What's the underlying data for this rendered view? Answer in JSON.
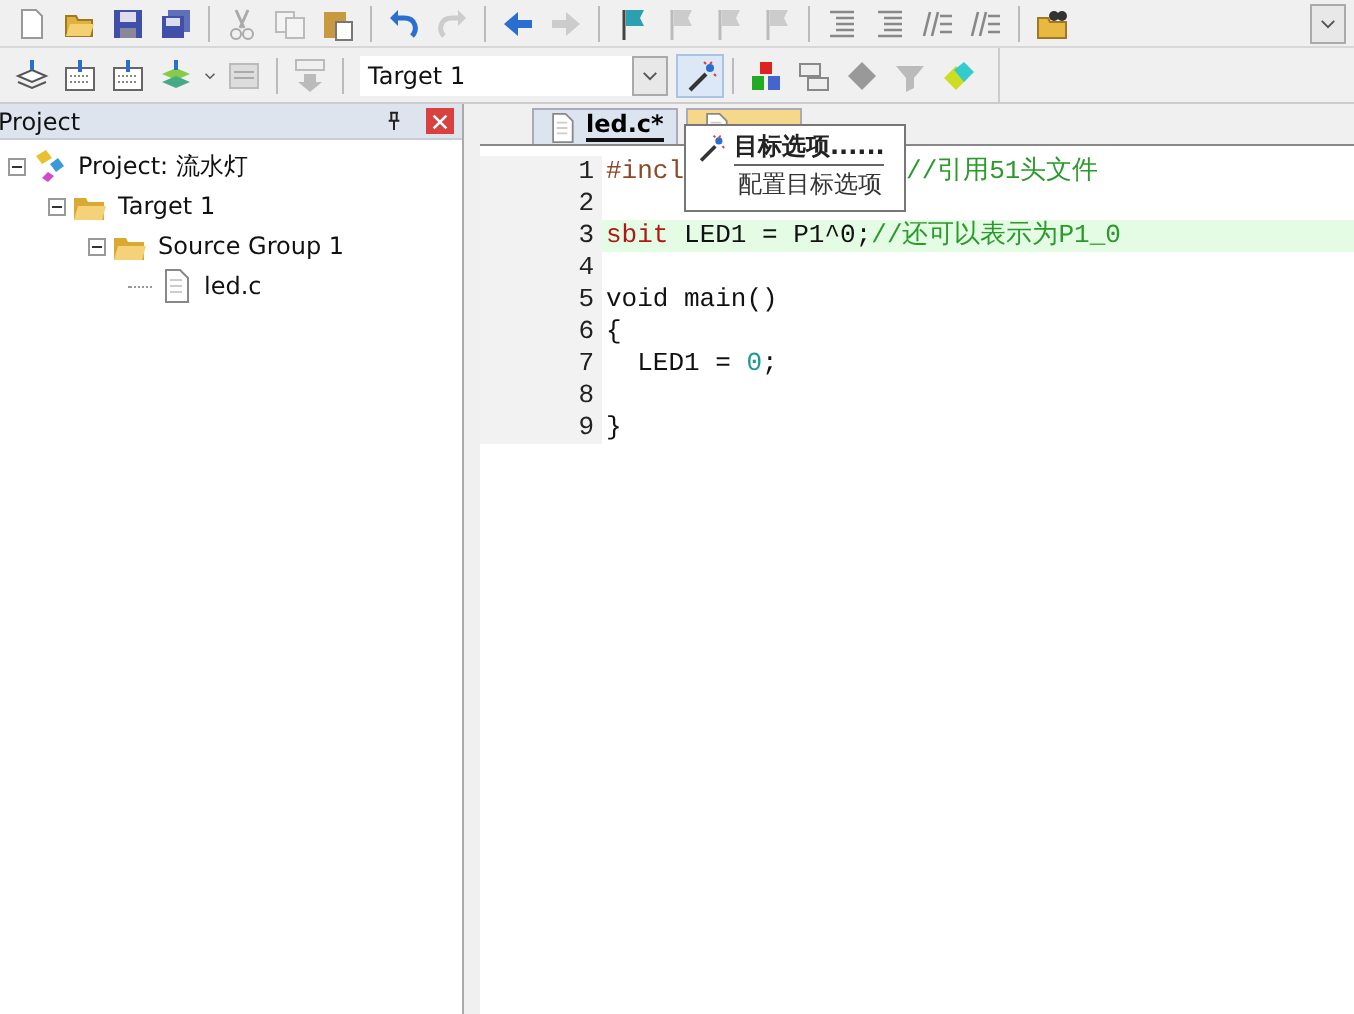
{
  "toolbar": {
    "target": "Target 1"
  },
  "project_panel": {
    "title": "Project",
    "tree": [
      {
        "kind": "project",
        "label": "Project: 流水灯",
        "expanded": true,
        "children": [
          {
            "kind": "target",
            "label": "Target 1",
            "expanded": true,
            "children": [
              {
                "kind": "group",
                "label": "Source Group 1",
                "expanded": true,
                "children": [
                  {
                    "kind": "file",
                    "label": "led.c"
                  }
                ]
              }
            ]
          }
        ]
      }
    ]
  },
  "editor": {
    "tabs": [
      {
        "label": "led.c*",
        "selected": true
      },
      {
        "selected": false
      }
    ],
    "lines": [
      {
        "number": "1",
        "current": false,
        "segments": [
          {
            "kind": "directive",
            "text": "#incl"
          },
          {
            "kind": "comment",
            "text": "//引用51头文件",
            "after_gap": true
          }
        ]
      },
      {
        "number": "2",
        "current": false
      },
      {
        "number": "3",
        "current": true,
        "segments": [
          {
            "kind": "keyword",
            "text": "sbit"
          },
          {
            "kind": "plain",
            "text": " LED1 = P1^0;"
          },
          {
            "kind": "comment",
            "text": "//还可以表示为P1_0"
          }
        ]
      },
      {
        "number": "4",
        "current": false
      },
      {
        "number": "5",
        "current": false,
        "segments": [
          {
            "kind": "plain",
            "text": "void main()"
          }
        ]
      },
      {
        "number": "6",
        "current": false,
        "segments": [
          {
            "kind": "plain",
            "text": "{"
          }
        ]
      },
      {
        "number": "7",
        "current": false,
        "segments": [
          {
            "kind": "plain",
            "text": "  LED1 = "
          },
          {
            "kind": "number",
            "text": "0"
          },
          {
            "kind": "plain",
            "text": ";"
          }
        ]
      },
      {
        "number": "8",
        "current": false
      },
      {
        "number": "9",
        "current": false,
        "segments": [
          {
            "kind": "plain",
            "text": "}"
          }
        ]
      }
    ]
  },
  "tooltip": {
    "title": "目标选项......",
    "description": "配置目标选项"
  }
}
